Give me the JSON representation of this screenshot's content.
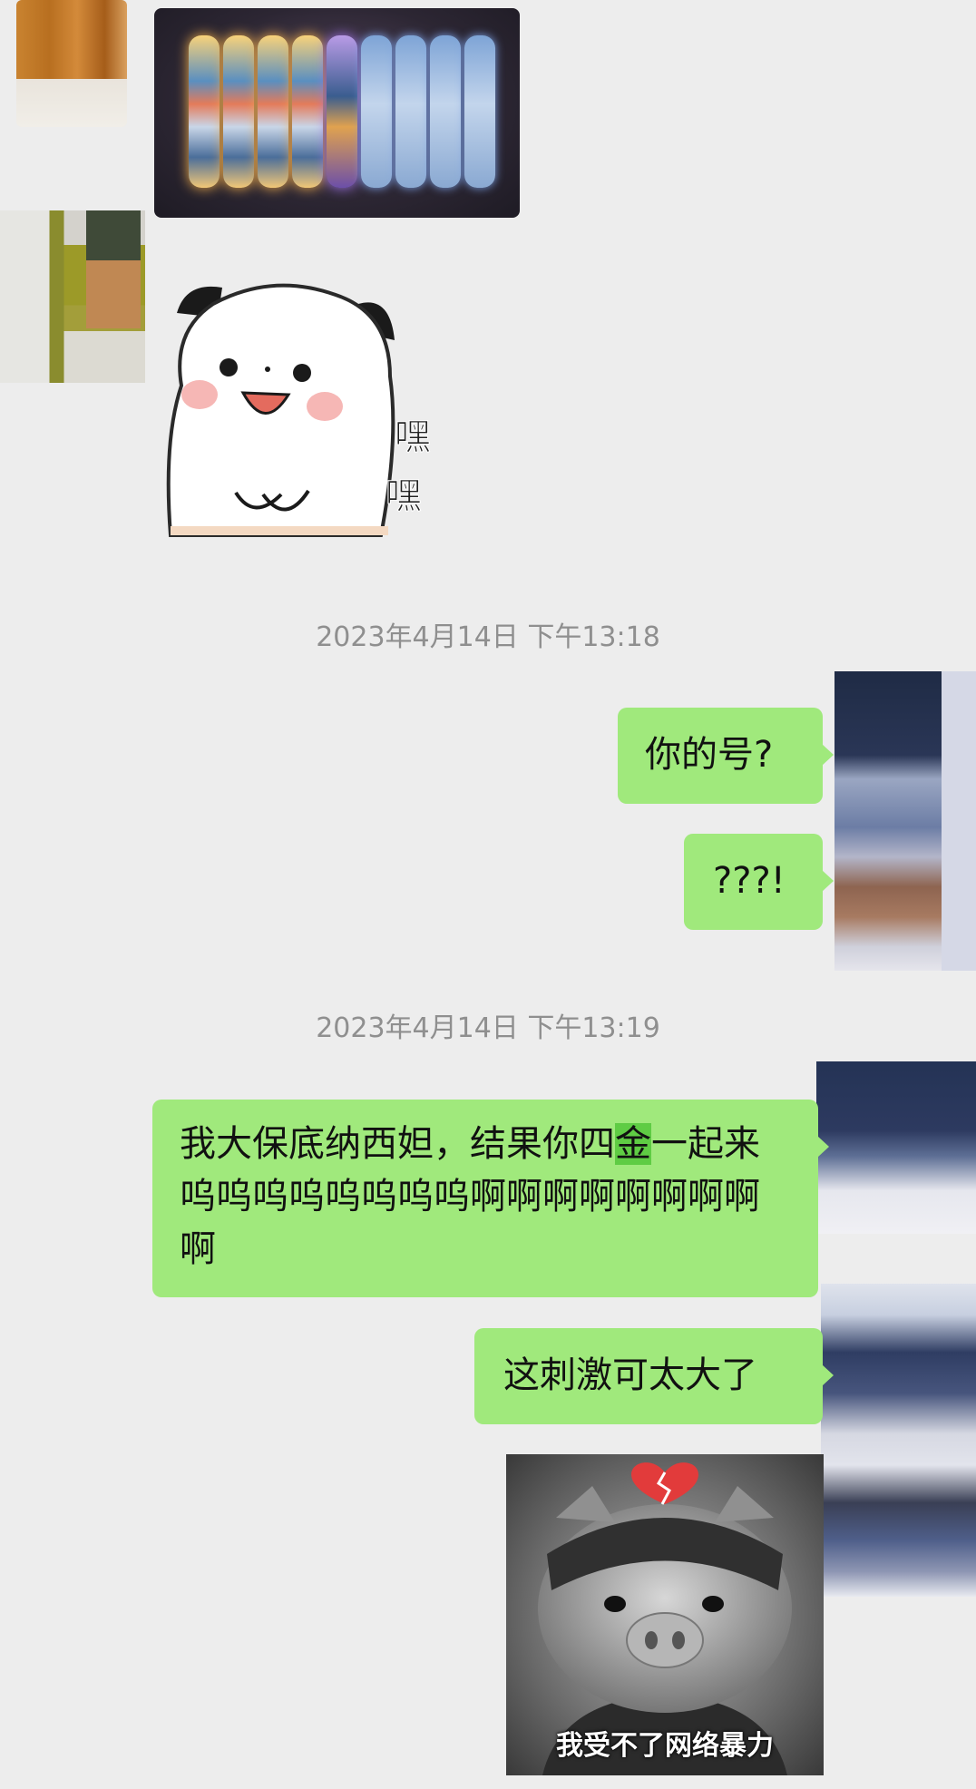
{
  "chat": {
    "timestamps": [
      "2023年4月14日 下午13:18",
      "2023年4月14日 下午13:19"
    ],
    "sticker_bun_text": [
      "嘿",
      "嘿"
    ],
    "messages": {
      "m1": "你的号?",
      "m2": "???!",
      "m3_before": "我大保底纳西妲，结果你四",
      "m3_highlight": "金",
      "m3_after": "一起来呜呜呜呜呜呜呜呜啊啊啊啊啊啊啊啊啊",
      "m4": "这刺激可太大了"
    },
    "pig_sticker_caption": "我受不了网络暴力"
  },
  "colors": {
    "background": "#ededed",
    "bubble_green": "#a0e97c",
    "timestamp_gray": "#8f8f8f"
  }
}
